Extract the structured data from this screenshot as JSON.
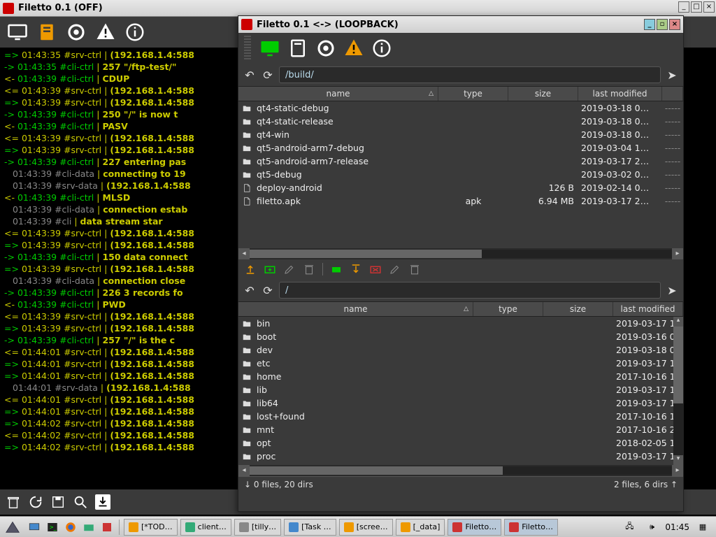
{
  "log_window": {
    "title": "Filetto 0.1 (OFF)",
    "toolbar_icons": [
      "monitor",
      "server",
      "gear",
      "warning",
      "info"
    ],
    "bottom_icons": [
      "trash",
      "reload",
      "save",
      "search",
      "download"
    ]
  },
  "log_lines": [
    {
      "dir": "=>",
      "ts": "01:43:35",
      "tag": "#srv-ctrl",
      "msg": "(192.168.1.4:588"
    },
    {
      "dir": "->",
      "ts": "01:43:35",
      "tag": "#cli-ctrl",
      "msg": "257 \"/ftp-test/\""
    },
    {
      "dir": "<-",
      "ts": "01:43:39",
      "tag": "#cli-ctrl",
      "msg": "CDUP"
    },
    {
      "dir": "<=",
      "ts": "01:43:39",
      "tag": "#srv-ctrl",
      "msg": "(192.168.1.4:588"
    },
    {
      "dir": "=>",
      "ts": "01:43:39",
      "tag": "#srv-ctrl",
      "msg": "(192.168.1.4:588"
    },
    {
      "dir": "->",
      "ts": "01:43:39",
      "tag": "#cli-ctrl",
      "msg": "250 \"/\" is now t"
    },
    {
      "dir": "<-",
      "ts": "01:43:39",
      "tag": "#cli-ctrl",
      "msg": "PASV"
    },
    {
      "dir": "<=",
      "ts": "01:43:39",
      "tag": "#srv-ctrl",
      "msg": "(192.168.1.4:588"
    },
    {
      "dir": "=>",
      "ts": "01:43:39",
      "tag": "#srv-ctrl",
      "msg": "(192.168.1.4:588"
    },
    {
      "dir": "->",
      "ts": "01:43:39",
      "tag": "#cli-ctrl",
      "msg": "227 entering pas"
    },
    {
      "dir": "  ",
      "ts": "01:43:39",
      "tag": "#cli-data",
      "msg": "connecting to 19"
    },
    {
      "dir": "  ",
      "ts": "01:43:39",
      "tag": "#srv-data",
      "msg": "(192.168.1.4:588"
    },
    {
      "dir": "<-",
      "ts": "01:43:39",
      "tag": "#cli-ctrl",
      "msg": "MLSD"
    },
    {
      "dir": "  ",
      "ts": "01:43:39",
      "tag": "#cli-data",
      "msg": "connection estab"
    },
    {
      "dir": "  ",
      "ts": "01:43:39",
      "tag": "#cli",
      "msg": "data stream star"
    },
    {
      "dir": "<=",
      "ts": "01:43:39",
      "tag": "#srv-ctrl",
      "msg": "(192.168.1.4:588"
    },
    {
      "dir": "=>",
      "ts": "01:43:39",
      "tag": "#srv-ctrl",
      "msg": "(192.168.1.4:588"
    },
    {
      "dir": "->",
      "ts": "01:43:39",
      "tag": "#cli-ctrl",
      "msg": "150 data connect"
    },
    {
      "dir": "=>",
      "ts": "01:43:39",
      "tag": "#srv-ctrl",
      "msg": "(192.168.1.4:588"
    },
    {
      "dir": "  ",
      "ts": "01:43:39",
      "tag": "#cli-data",
      "msg": "connection close"
    },
    {
      "dir": "->",
      "ts": "01:43:39",
      "tag": "#cli-ctrl",
      "msg": "226 3 records fo"
    },
    {
      "dir": "<-",
      "ts": "01:43:39",
      "tag": "#cli-ctrl",
      "msg": "PWD"
    },
    {
      "dir": "<=",
      "ts": "01:43:39",
      "tag": "#srv-ctrl",
      "msg": "(192.168.1.4:588"
    },
    {
      "dir": "=>",
      "ts": "01:43:39",
      "tag": "#srv-ctrl",
      "msg": "(192.168.1.4:588"
    },
    {
      "dir": "->",
      "ts": "01:43:39",
      "tag": "#cli-ctrl",
      "msg": "257 \"/\" is the c"
    },
    {
      "dir": "<=",
      "ts": "01:44:01",
      "tag": "#srv-ctrl",
      "msg": "(192.168.1.4:588"
    },
    {
      "dir": "=>",
      "ts": "01:44:01",
      "tag": "#srv-ctrl",
      "msg": "(192.168.1.4:588"
    },
    {
      "dir": "=>",
      "ts": "01:44:01",
      "tag": "#srv-ctrl",
      "msg": "(192.168.1.4:588"
    },
    {
      "dir": "  ",
      "ts": "01:44:01",
      "tag": "#srv-data",
      "msg": "(192.168.1.4:588"
    },
    {
      "dir": "<=",
      "ts": "01:44:01",
      "tag": "#srv-ctrl",
      "msg": "(192.168.1.4:588"
    },
    {
      "dir": "=>",
      "ts": "01:44:01",
      "tag": "#srv-ctrl",
      "msg": "(192.168.1.4:588"
    },
    {
      "dir": "=>",
      "ts": "01:44:02",
      "tag": "#srv-ctrl",
      "msg": "(192.168.1.4:588"
    },
    {
      "dir": "<=",
      "ts": "01:44:02",
      "tag": "#srv-ctrl",
      "msg": "(192.168.1.4:588"
    },
    {
      "dir": "=>",
      "ts": "01:44:02",
      "tag": "#srv-ctrl",
      "msg": "(192.168.1.4:588"
    }
  ],
  "file_window": {
    "title": "Filetto 0.1 <-> (LOOPBACK)",
    "toolbar_icons": [
      "monitor-green",
      "server",
      "gear",
      "warning-orange",
      "info"
    ],
    "top_pane": {
      "path": "/build/",
      "columns": [
        "name",
        "type",
        "size",
        "last modified"
      ],
      "rows": [
        {
          "icon": "folder",
          "name": "qt4-static-debug",
          "type": "",
          "size": "",
          "mod": "2019-03-18 0…",
          "dash": "-----"
        },
        {
          "icon": "folder",
          "name": "qt4-static-release",
          "type": "",
          "size": "",
          "mod": "2019-03-18 0…",
          "dash": "-----"
        },
        {
          "icon": "folder",
          "name": "qt4-win",
          "type": "",
          "size": "",
          "mod": "2019-03-18 0…",
          "dash": "-----"
        },
        {
          "icon": "folder",
          "name": "qt5-android-arm7-debug",
          "type": "",
          "size": "",
          "mod": "2019-03-04 1…",
          "dash": "-----"
        },
        {
          "icon": "folder",
          "name": "qt5-android-arm7-release",
          "type": "",
          "size": "",
          "mod": "2019-03-17 2…",
          "dash": "-----"
        },
        {
          "icon": "folder",
          "name": "qt5-debug",
          "type": "",
          "size": "",
          "mod": "2019-03-02 0…",
          "dash": "-----"
        },
        {
          "icon": "file",
          "name": "deploy-android",
          "type": "",
          "size": "126 B",
          "mod": "2019-02-14 0…",
          "dash": "-----"
        },
        {
          "icon": "file",
          "name": "filetto.apk",
          "type": "apk",
          "size": "6.94 MB",
          "mod": "2019-03-17 2…",
          "dash": "-----"
        }
      ]
    },
    "action_icons": [
      "upload",
      "newfolder",
      "edit",
      "delete",
      "sep",
      "drive",
      "download",
      "stop",
      "edit2",
      "delete2"
    ],
    "bottom_pane": {
      "path": "/",
      "columns": [
        "name",
        "type",
        "size",
        "last modified"
      ],
      "rows": [
        {
          "icon": "folder",
          "name": "bin",
          "mod": "2019-03-17 1"
        },
        {
          "icon": "folder",
          "name": "boot",
          "mod": "2019-03-16 0"
        },
        {
          "icon": "folder",
          "name": "dev",
          "mod": "2019-03-18 0"
        },
        {
          "icon": "folder",
          "name": "etc",
          "mod": "2019-03-17 1"
        },
        {
          "icon": "folder",
          "name": "home",
          "mod": "2017-10-16 1"
        },
        {
          "icon": "folder",
          "name": "lib",
          "mod": "2019-03-17 1"
        },
        {
          "icon": "folder",
          "name": "lib64",
          "mod": "2019-03-17 1"
        },
        {
          "icon": "folder",
          "name": "lost+found",
          "mod": "2017-10-16 1"
        },
        {
          "icon": "folder",
          "name": "mnt",
          "mod": "2017-10-16 2"
        },
        {
          "icon": "folder",
          "name": "opt",
          "mod": "2018-02-05 1"
        },
        {
          "icon": "folder",
          "name": "proc",
          "mod": "2019-03-17 1"
        }
      ]
    },
    "status": {
      "left": "↓ 0 files, 20 dirs",
      "right": "2 files, 6 dirs ↑"
    }
  },
  "taskbar": {
    "tasks": [
      "[*TOD…",
      "client…",
      "[tilly…",
      "[Task …",
      "[scree…",
      "[_data]",
      "Filetto…",
      "Filetto…"
    ],
    "clock": "01:45"
  }
}
